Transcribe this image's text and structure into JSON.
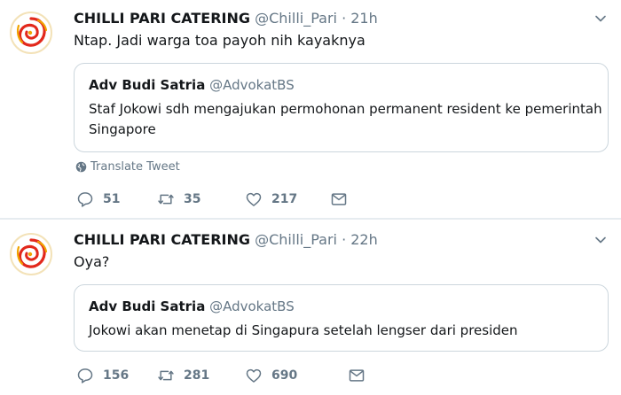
{
  "colors": {
    "text": "#14171a",
    "secondary": "#657786",
    "border": "#ccd6dd",
    "logo_red": "#e2281c",
    "logo_gold": "#f0a400"
  },
  "tweets": [
    {
      "name": "CHILLI PARI CATERING",
      "handle": "@Chilli_Pari",
      "dot": "·",
      "time": "21h",
      "text": "Ntap. Jadi warga toa payoh nih kayaknya",
      "quote": {
        "name": "Adv Budi Satria",
        "handle": "@AdvokatBS",
        "text": "Staf Jokowi sdh mengajukan permohonan permanent resident ke pemerintah Singapore"
      },
      "translate_label": "Translate Tweet",
      "replies": "51",
      "retweets": "35",
      "likes": "217"
    },
    {
      "name": "CHILLI PARI CATERING",
      "handle": "@Chilli_Pari",
      "dot": "·",
      "time": "22h",
      "text": "Oya?",
      "quote": {
        "name": "Adv Budi Satria",
        "handle": "@AdvokatBS",
        "text": "Jokowi akan menetap di Singapura setelah lengser dari presiden"
      },
      "replies": "156",
      "retweets": "281",
      "likes": "690"
    }
  ]
}
